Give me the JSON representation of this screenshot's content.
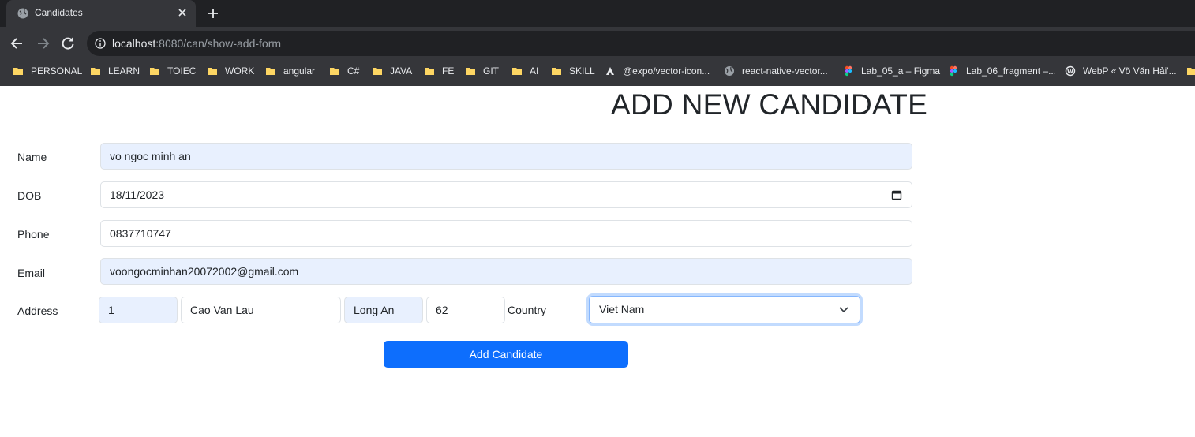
{
  "browser": {
    "tab_title": "Candidates",
    "url_host": "localhost",
    "url_rest": ":8080/can/show-add-form",
    "bookmarks": [
      {
        "label": "PERSONAL",
        "icon": "folder-icon"
      },
      {
        "label": "LEARN",
        "icon": "folder-icon"
      },
      {
        "label": "TOIEC",
        "icon": "folder-icon"
      },
      {
        "label": "WORK",
        "icon": "folder-icon"
      },
      {
        "label": "angular",
        "icon": "folder-icon"
      },
      {
        "label": "C#",
        "icon": "folder-icon"
      },
      {
        "label": "JAVA",
        "icon": "folder-icon"
      },
      {
        "label": "FE",
        "icon": "folder-icon"
      },
      {
        "label": "GIT",
        "icon": "folder-icon"
      },
      {
        "label": "AI",
        "icon": "folder-icon"
      },
      {
        "label": "SKILL",
        "icon": "folder-icon"
      },
      {
        "label": "@expo/vector-icon...",
        "icon": "expo-icon"
      },
      {
        "label": "react-native-vector...",
        "icon": "globe-icon"
      },
      {
        "label": "Lab_05_a – Figma",
        "icon": "figma-icon"
      },
      {
        "label": "Lab_06_fragment –...",
        "icon": "figma-icon"
      },
      {
        "label": "WebP « Võ Văn Hải'...",
        "icon": "wordpress-icon"
      }
    ]
  },
  "form": {
    "heading": "ADD NEW CANDIDATE",
    "name_label": "Name",
    "name_value": "vo ngoc minh an",
    "dob_label": "DOB",
    "dob_value": "18/11/2023",
    "phone_label": "Phone",
    "phone_value": "0837710747",
    "email_label": "Email",
    "email_value": "voongocminhan20072002@gmail.com",
    "address_label": "Address",
    "address_number": "1",
    "address_street": "Cao Van Lau",
    "address_city": "Long An",
    "address_zip": "62",
    "country_label": "Country",
    "country_selected": "Viet Nam",
    "submit_label": "Add Candidate"
  },
  "colors": {
    "accent": "#0d6efd",
    "autofill": "#e8f0fe",
    "chrome_dark": "#202124",
    "chrome_mid": "#35363a"
  }
}
